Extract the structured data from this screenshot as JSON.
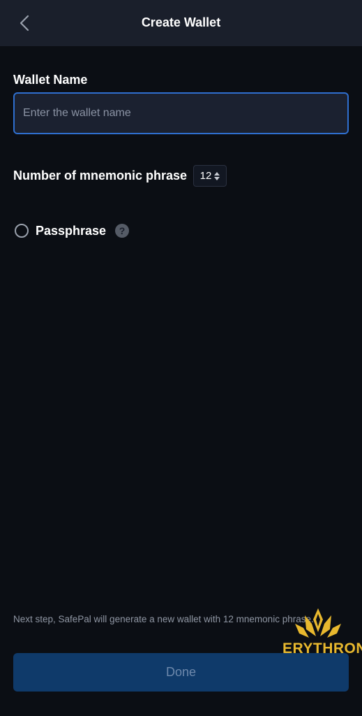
{
  "header": {
    "title": "Create Wallet",
    "back_icon": "chevron-left-icon"
  },
  "wallet_name": {
    "label": "Wallet Name",
    "value": "",
    "placeholder": "Enter the wallet name"
  },
  "mnemonic": {
    "label": "Number of mnemonic phrase",
    "selected": "12",
    "icon": "sort-arrows-icon"
  },
  "passphrase": {
    "label": "Passphrase",
    "checked": false,
    "help_icon_glyph": "?"
  },
  "footer": {
    "note": "Next step, SafePal will generate a new wallet with 12 mnemonic phrase.",
    "done_label": "Done"
  },
  "watermark": {
    "text": "ERYTHRON"
  },
  "colors": {
    "background": "#0b0e14",
    "header": "#1a1f2b",
    "accent": "#2f6fcf",
    "button": "#0f3a6a",
    "watermark": "#e8b82e"
  }
}
